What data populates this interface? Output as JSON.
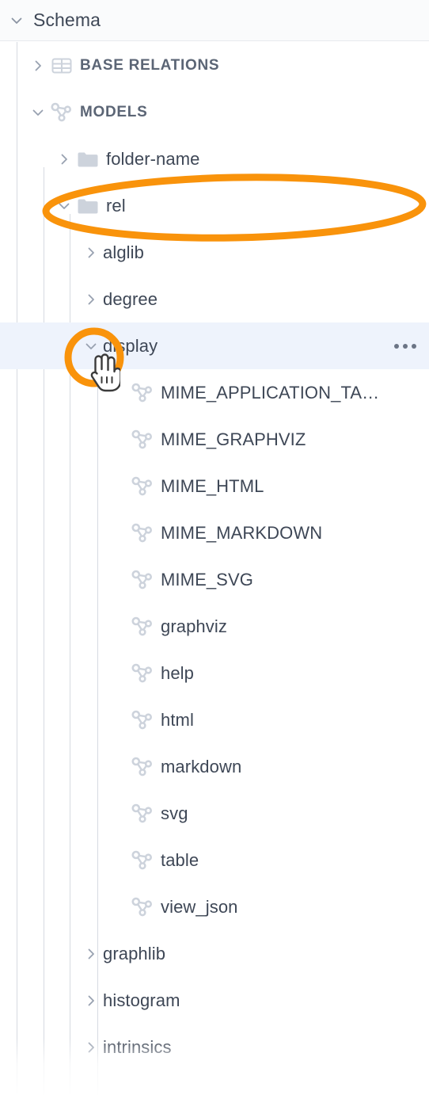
{
  "header": {
    "title": "Schema",
    "chevron": "chevron-down-icon"
  },
  "colors": {
    "annotation_orange": "#F9930B",
    "selected_row_bg": "#EEF3FC",
    "text": "#3E4756",
    "icon_gray": "#CDD3DC",
    "guide_line": "#D6DAE1"
  },
  "tree": {
    "rows": [
      {
        "label": "BASE RELATIONS",
        "kind": "section",
        "icon": "table-grid-icon",
        "twisty": "chevron-right-icon",
        "expanded": false,
        "depth": 0
      },
      {
        "label": "MODELS",
        "kind": "section",
        "icon": "model-graph-icon",
        "twisty": "chevron-down-icon",
        "expanded": true,
        "depth": 0
      },
      {
        "label": "folder-name",
        "kind": "folder",
        "icon": "folder-icon",
        "twisty": "chevron-right-icon",
        "expanded": false,
        "depth": 1
      },
      {
        "label": "rel",
        "kind": "folder",
        "icon": "folder-icon",
        "twisty": "chevron-down-icon",
        "expanded": true,
        "depth": 1,
        "annotated": true
      },
      {
        "label": "alglib",
        "kind": "group",
        "icon": "none",
        "twisty": "chevron-right-icon",
        "expanded": false,
        "depth": 2
      },
      {
        "label": "degree",
        "kind": "group",
        "icon": "none",
        "twisty": "chevron-right-icon",
        "expanded": false,
        "depth": 2
      },
      {
        "label": "display",
        "kind": "group",
        "icon": "none",
        "twisty": "chevron-down-icon",
        "expanded": true,
        "depth": 2,
        "selected": true,
        "has_more_menu": true
      },
      {
        "label": "MIME_APPLICATION_TA…",
        "kind": "model",
        "icon": "model-graph-icon",
        "twisty": "none",
        "depth": 3
      },
      {
        "label": "MIME_GRAPHVIZ",
        "kind": "model",
        "icon": "model-graph-icon",
        "twisty": "none",
        "depth": 3
      },
      {
        "label": "MIME_HTML",
        "kind": "model",
        "icon": "model-graph-icon",
        "twisty": "none",
        "depth": 3
      },
      {
        "label": "MIME_MARKDOWN",
        "kind": "model",
        "icon": "model-graph-icon",
        "twisty": "none",
        "depth": 3
      },
      {
        "label": "MIME_SVG",
        "kind": "model",
        "icon": "model-graph-icon",
        "twisty": "none",
        "depth": 3
      },
      {
        "label": "graphviz",
        "kind": "model",
        "icon": "model-graph-icon",
        "twisty": "none",
        "depth": 3
      },
      {
        "label": "help",
        "kind": "model",
        "icon": "model-graph-icon",
        "twisty": "none",
        "depth": 3
      },
      {
        "label": "html",
        "kind": "model",
        "icon": "model-graph-icon",
        "twisty": "none",
        "depth": 3
      },
      {
        "label": "markdown",
        "kind": "model",
        "icon": "model-graph-icon",
        "twisty": "none",
        "depth": 3
      },
      {
        "label": "svg",
        "kind": "model",
        "icon": "model-graph-icon",
        "twisty": "none",
        "depth": 3
      },
      {
        "label": "table",
        "kind": "model",
        "icon": "model-graph-icon",
        "twisty": "none",
        "depth": 3
      },
      {
        "label": "view_json",
        "kind": "model",
        "icon": "model-graph-icon",
        "twisty": "none",
        "depth": 3
      },
      {
        "label": "graphlib",
        "kind": "group",
        "icon": "none",
        "twisty": "chevron-right-icon",
        "expanded": false,
        "depth": 2
      },
      {
        "label": "histogram",
        "kind": "group",
        "icon": "none",
        "twisty": "chevron-right-icon",
        "expanded": false,
        "depth": 2
      },
      {
        "label": "intrinsics",
        "kind": "group",
        "icon": "none",
        "twisty": "chevron-right-icon",
        "expanded": false,
        "depth": 2
      }
    ]
  },
  "annotations": [
    {
      "type": "ellipse",
      "target": "rel",
      "color": "#F9930B"
    },
    {
      "type": "circle",
      "target": "display-twisty",
      "color": "#F9930B"
    },
    {
      "type": "cursor",
      "shape": "pointing-hand-cursor",
      "target": "display-twisty"
    }
  ]
}
